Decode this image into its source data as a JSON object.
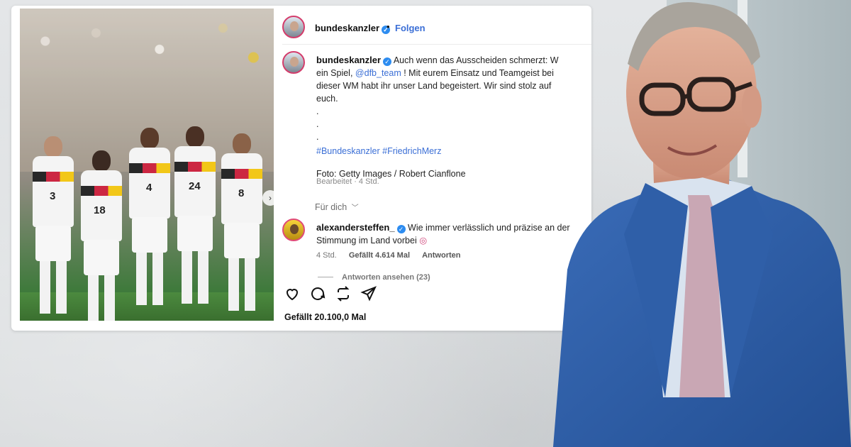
{
  "post": {
    "header": {
      "username": "bundeskanzler",
      "separator": "•",
      "follow_label": "Folgen"
    },
    "caption": {
      "username": "bundeskanzler",
      "text_1": "Auch wenn das Ausscheiden schmerzt: W",
      "text_2": "ein Spiel,",
      "mention": "@dfb_team",
      "text_3": "! Mit eurem Einsatz und Teamgeist bei",
      "text_4": "dieser WM habt ihr unser Land begeistert. Wir sind stolz auf",
      "text_5": "euch.",
      "dots": [
        ".",
        ".",
        "."
      ],
      "hashtags": "#Bundeskanzler #FriedrichMerz",
      "photo_credit": "Foto: Getty Images / Robert Cianflone",
      "edited": "Bearbeitet · 4 Std."
    },
    "for_you_label": "Für dich",
    "comment": {
      "username": "alexandersteffen_",
      "text_1": "Wie immer verlässlich und präzise an der",
      "text_2": "Stimmung im Land vorbei",
      "time": "4 Std.",
      "likes": "Gefällt 4.614 Mal",
      "reply_label": "Antworten",
      "view_replies": "Antworten ansehen (23)"
    },
    "likes_total": "Gefällt 20.100,0 Mal",
    "photo": {
      "jersey_numbers": [
        "3",
        "18",
        "4",
        "24",
        "8"
      ]
    }
  },
  "icons": {
    "like": "heart-icon",
    "comment": "comment-icon",
    "repost": "repost-icon",
    "share": "share-icon",
    "verified": "verified-icon",
    "chevron": "chevron-down-icon",
    "carousel": "chevron-right-icon"
  },
  "colors": {
    "link": "#3b6fd6",
    "verified": "#2d8cf0",
    "suit": "#2f5fa8"
  }
}
